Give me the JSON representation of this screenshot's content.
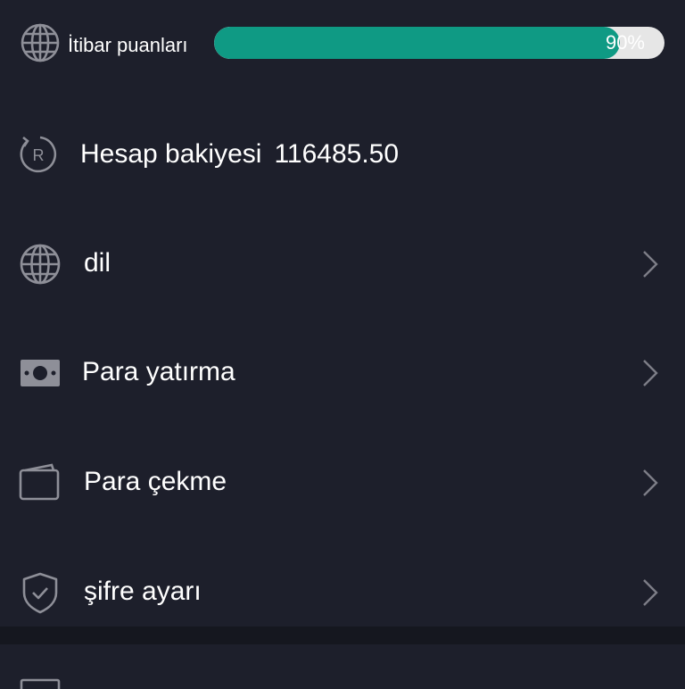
{
  "reputation": {
    "label": "İtibar puanları",
    "value_text": "90%",
    "progress_percent": 90
  },
  "balance": {
    "label": "Hesap bakiyesi",
    "value": "116485.50"
  },
  "menu": [
    {
      "label": "dil",
      "icon": "globe-icon"
    },
    {
      "label": "Para yatırma",
      "icon": "cash-icon"
    },
    {
      "label": "Para çekme",
      "icon": "wallet-icon"
    },
    {
      "label": "şifre ayarı",
      "icon": "shield-check-icon"
    }
  ],
  "colors": {
    "background": "#1d1f2b",
    "accent": "#0f9a84",
    "track": "#e6e6e6",
    "icon": "#8e8f98",
    "chevron": "#7d7e87"
  }
}
